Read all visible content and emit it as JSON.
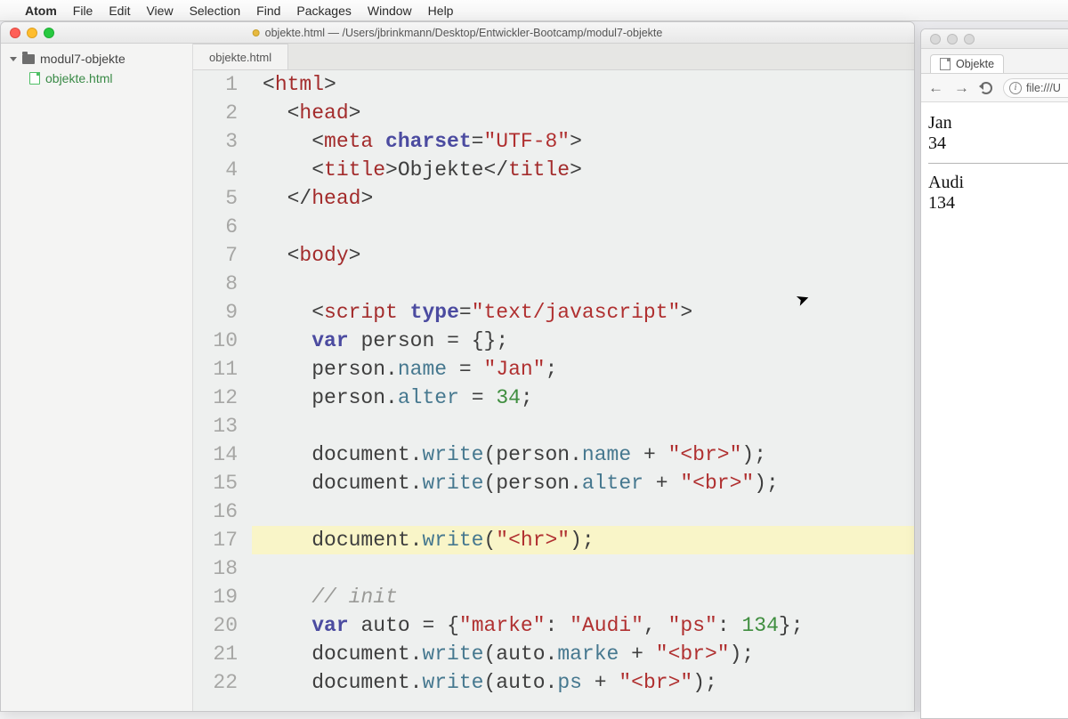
{
  "menubar": {
    "apple": "",
    "appname": "Atom",
    "items": [
      "File",
      "Edit",
      "View",
      "Selection",
      "Find",
      "Packages",
      "Window",
      "Help"
    ]
  },
  "atom": {
    "title": "objekte.html — /Users/jbrinkmann/Desktop/Entwickler-Bootcamp/modul7-objekte",
    "tree": {
      "root": "modul7-objekte",
      "file": "objekte.html"
    },
    "tab": "objekte.html",
    "highlighted_line": 17,
    "code_lines": [
      [
        [
          "pun",
          "<"
        ],
        [
          "tag",
          "html"
        ],
        [
          "pun",
          ">"
        ]
      ],
      [
        [
          "pun",
          "  <"
        ],
        [
          "tag",
          "head"
        ],
        [
          "pun",
          ">"
        ]
      ],
      [
        [
          "pun",
          "    <"
        ],
        [
          "tag",
          "meta"
        ],
        [
          "txt",
          " "
        ],
        [
          "attn",
          "charset"
        ],
        [
          "pun",
          "="
        ],
        [
          "str",
          "\"UTF-8\""
        ],
        [
          "pun",
          ">"
        ]
      ],
      [
        [
          "pun",
          "    <"
        ],
        [
          "tag",
          "title"
        ],
        [
          "pun",
          ">"
        ],
        [
          "txt",
          "Objekte"
        ],
        [
          "pun",
          "</"
        ],
        [
          "tag",
          "title"
        ],
        [
          "pun",
          ">"
        ]
      ],
      [
        [
          "pun",
          "  </"
        ],
        [
          "tag",
          "head"
        ],
        [
          "pun",
          ">"
        ]
      ],
      [],
      [
        [
          "pun",
          "  <"
        ],
        [
          "tag",
          "body"
        ],
        [
          "pun",
          ">"
        ]
      ],
      [],
      [
        [
          "pun",
          "    <"
        ],
        [
          "tag",
          "script"
        ],
        [
          "txt",
          " "
        ],
        [
          "attn",
          "type"
        ],
        [
          "pun",
          "="
        ],
        [
          "str",
          "\"text/javascript\""
        ],
        [
          "pun",
          ">"
        ]
      ],
      [
        [
          "txt",
          "    "
        ],
        [
          "kw",
          "var"
        ],
        [
          "txt",
          " "
        ],
        [
          "nm",
          "person"
        ],
        [
          "txt",
          " "
        ],
        [
          "pun",
          "="
        ],
        [
          "txt",
          " "
        ],
        [
          "pun",
          "{};"
        ]
      ],
      [
        [
          "txt",
          "    "
        ],
        [
          "nm",
          "person"
        ],
        [
          "pun",
          "."
        ],
        [
          "fn",
          "name"
        ],
        [
          "txt",
          " "
        ],
        [
          "pun",
          "="
        ],
        [
          "txt",
          " "
        ],
        [
          "str",
          "\"Jan\""
        ],
        [
          "pun",
          ";"
        ]
      ],
      [
        [
          "txt",
          "    "
        ],
        [
          "nm",
          "person"
        ],
        [
          "pun",
          "."
        ],
        [
          "fn",
          "alter"
        ],
        [
          "txt",
          " "
        ],
        [
          "pun",
          "="
        ],
        [
          "txt",
          " "
        ],
        [
          "num",
          "34"
        ],
        [
          "pun",
          ";"
        ]
      ],
      [],
      [
        [
          "txt",
          "    "
        ],
        [
          "nm",
          "document"
        ],
        [
          "pun",
          "."
        ],
        [
          "fn",
          "write"
        ],
        [
          "pun",
          "("
        ],
        [
          "nm",
          "person"
        ],
        [
          "pun",
          "."
        ],
        [
          "fn",
          "name"
        ],
        [
          "txt",
          " "
        ],
        [
          "pun",
          "+"
        ],
        [
          "txt",
          " "
        ],
        [
          "str",
          "\"<br>\""
        ],
        [
          "pun",
          ");"
        ]
      ],
      [
        [
          "txt",
          "    "
        ],
        [
          "nm",
          "document"
        ],
        [
          "pun",
          "."
        ],
        [
          "fn",
          "write"
        ],
        [
          "pun",
          "("
        ],
        [
          "nm",
          "person"
        ],
        [
          "pun",
          "."
        ],
        [
          "fn",
          "alter"
        ],
        [
          "txt",
          " "
        ],
        [
          "pun",
          "+"
        ],
        [
          "txt",
          " "
        ],
        [
          "str",
          "\"<br>\""
        ],
        [
          "pun",
          ");"
        ]
      ],
      [],
      [
        [
          "txt",
          "    "
        ],
        [
          "nm",
          "document"
        ],
        [
          "pun",
          "."
        ],
        [
          "fn",
          "write"
        ],
        [
          "pun",
          "("
        ],
        [
          "str",
          "\"<hr>\""
        ],
        [
          "pun",
          ");"
        ]
      ],
      [],
      [
        [
          "txt",
          "    "
        ],
        [
          "cm",
          "// init"
        ]
      ],
      [
        [
          "txt",
          "    "
        ],
        [
          "kw",
          "var"
        ],
        [
          "txt",
          " "
        ],
        [
          "nm",
          "auto"
        ],
        [
          "txt",
          " "
        ],
        [
          "pun",
          "="
        ],
        [
          "txt",
          " "
        ],
        [
          "pun",
          "{"
        ],
        [
          "str",
          "\"marke\""
        ],
        [
          "pun",
          ":"
        ],
        [
          "txt",
          " "
        ],
        [
          "str",
          "\"Audi\""
        ],
        [
          "pun",
          ","
        ],
        [
          "txt",
          " "
        ],
        [
          "str",
          "\"ps\""
        ],
        [
          "pun",
          ":"
        ],
        [
          "txt",
          " "
        ],
        [
          "num",
          "134"
        ],
        [
          "pun",
          "};"
        ]
      ],
      [
        [
          "txt",
          "    "
        ],
        [
          "nm",
          "document"
        ],
        [
          "pun",
          "."
        ],
        [
          "fn",
          "write"
        ],
        [
          "pun",
          "("
        ],
        [
          "nm",
          "auto"
        ],
        [
          "pun",
          "."
        ],
        [
          "fn",
          "marke"
        ],
        [
          "txt",
          " "
        ],
        [
          "pun",
          "+"
        ],
        [
          "txt",
          " "
        ],
        [
          "str",
          "\"<br>\""
        ],
        [
          "pun",
          ");"
        ]
      ],
      [
        [
          "txt",
          "    "
        ],
        [
          "nm",
          "document"
        ],
        [
          "pun",
          "."
        ],
        [
          "fn",
          "write"
        ],
        [
          "pun",
          "("
        ],
        [
          "nm",
          "auto"
        ],
        [
          "pun",
          "."
        ],
        [
          "fn",
          "ps"
        ],
        [
          "txt",
          " "
        ],
        [
          "pun",
          "+"
        ],
        [
          "txt",
          " "
        ],
        [
          "str",
          "\"<br>\""
        ],
        [
          "pun",
          ");"
        ]
      ]
    ]
  },
  "browser": {
    "tab_title": "Objekte",
    "address": "file:///U",
    "output": {
      "before_hr": [
        "Jan",
        "34"
      ],
      "after_hr": [
        "Audi",
        "134"
      ]
    }
  }
}
